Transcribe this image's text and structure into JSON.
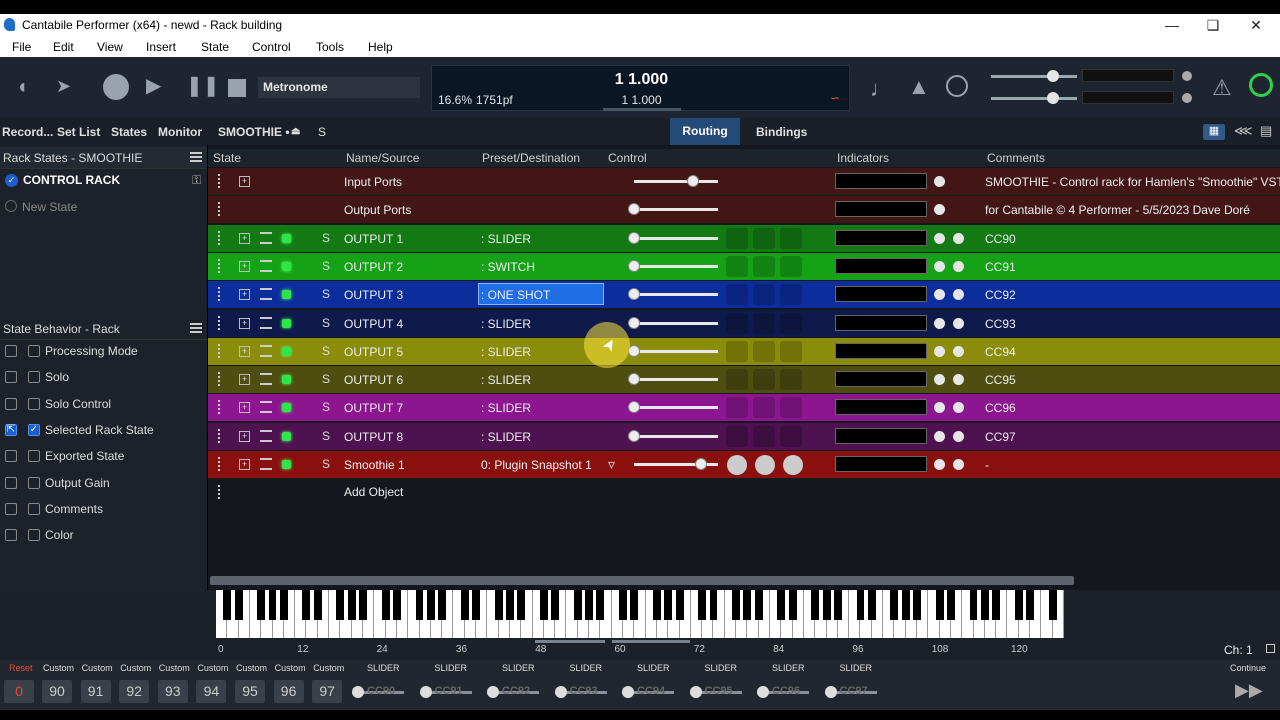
{
  "title": "Cantabile Performer (x64) - newd - Rack building",
  "menu": [
    "File",
    "Edit",
    "View",
    "Insert",
    "State",
    "Control",
    "Tools",
    "Help"
  ],
  "toolbar": {
    "metronome": "Metronome",
    "position_big": "1 1.000",
    "position_small": "1 1.000",
    "load": "16.6%",
    "pf": "1751pf"
  },
  "tabs": {
    "record": "Record...",
    "setlist": "Set List",
    "states": "States",
    "monitor": "Monitor",
    "rack": "SMOOTHIE •",
    "s": "S",
    "routing": "Routing",
    "bindings": "Bindings"
  },
  "rack_states": {
    "header": "Rack States - SMOOTHIE",
    "items": [
      "CONTROL RACK",
      "New State"
    ]
  },
  "behavior": {
    "header": "State Behavior - Rack",
    "items": [
      "Processing Mode",
      "Solo",
      "Solo Control",
      "Selected Rack State",
      "Exported State",
      "Output Gain",
      "Comments",
      "Color"
    ]
  },
  "columns": [
    "State",
    "Name/Source",
    "Preset/Destination",
    "Control",
    "Indicators",
    "Comments"
  ],
  "rows": [
    {
      "name": "Input Ports",
      "preset": "",
      "comment": "SMOOTHIE - Control rack for Hamlen's \"Smoothie\" VST3",
      "color": "#431616",
      "level": 0.7
    },
    {
      "name": "Output Ports",
      "preset": "",
      "comment": "for Cantabile © 4 Performer - 5/5/2023  Dave Doré",
      "color": "#431616",
      "level": 0
    },
    {
      "name": "OUTPUT 1",
      "preset": ": SLIDER",
      "comment": "CC90",
      "color": "#137a13",
      "level": 0
    },
    {
      "name": "OUTPUT 2",
      "preset": ": SWITCH",
      "comment": "CC91",
      "color": "#16a216",
      "level": 0
    },
    {
      "name": "OUTPUT 3",
      "preset": ": ONE SHOT",
      "comment": "CC92",
      "color": "#0c2e9c",
      "level": 0
    },
    {
      "name": "OUTPUT 4",
      "preset": ": SLIDER",
      "comment": "CC93",
      "color": "#0e1a4c",
      "level": 0
    },
    {
      "name": "OUTPUT 5",
      "preset": ": SLIDER",
      "comment": "CC94",
      "color": "#8c8c0c",
      "level": 0
    },
    {
      "name": "OUTPUT 6",
      "preset": ": SLIDER",
      "comment": "CC95",
      "color": "#4e4e10",
      "level": 0
    },
    {
      "name": "OUTPUT 7",
      "preset": ": SLIDER",
      "comment": "CC96",
      "color": "#8c1690",
      "level": 0
    },
    {
      "name": "OUTPUT 8",
      "preset": ": SLIDER",
      "comment": "CC97",
      "color": "#4e1250",
      "level": 0
    },
    {
      "name": "Smoothie 1",
      "preset": "0: Plugin Snapshot 1",
      "comment": "-",
      "color": "#8a1010",
      "level": 0.8
    }
  ],
  "add_object": "Add Object",
  "piano_labels": [
    "0",
    "12",
    "24",
    "36",
    "48",
    "60",
    "72",
    "84",
    "96",
    "108",
    "120"
  ],
  "channel": "Ch: 1",
  "bottom": {
    "reset": "Reset",
    "reset_val": "0",
    "custom_label": "Custom",
    "custom_vals": [
      "90",
      "91",
      "92",
      "93",
      "94",
      "95",
      "96",
      "97"
    ],
    "slider_label": "SLIDER",
    "slider_vals": [
      "CC90",
      "CC91",
      "CC92",
      "CC93",
      "CC94",
      "CC95",
      "CC96",
      "CC97"
    ],
    "continue": "Continue"
  }
}
